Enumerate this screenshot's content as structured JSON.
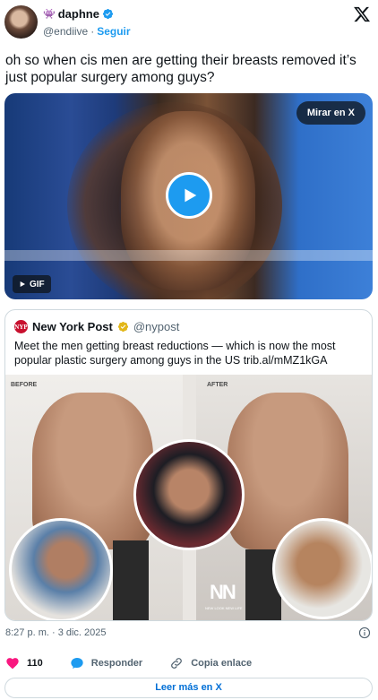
{
  "author": {
    "display_name": "daphne",
    "name_emoji": "👾",
    "handle": "@endiive",
    "separator": "·",
    "follow_label": "Seguir",
    "verified": true
  },
  "tweet": {
    "text": "oh so when cis men are getting their breasts removed it’s just popular surgery among guys?",
    "timestamp": "8:27 p. m. · 3 dic. 2025"
  },
  "media": {
    "watch_label": "Mirar en X",
    "badge": "GIF"
  },
  "quote": {
    "name": "New York Post",
    "logo_text": "NYP",
    "handle": "@nypost",
    "text": "Meet the men getting breast reductions — which is now the most popular plastic surgery among guys in the US trib.al/mMZ1kGA",
    "image": {
      "label_before": "BEFORE",
      "label_after": "AFTER",
      "mark": "NN",
      "mark_sub": "NEW LOOK NEW LIFE"
    }
  },
  "actions": {
    "likes": "110",
    "reply_label": "Responder",
    "copy_label": "Copia enlace"
  },
  "read_more": "Leer más en X",
  "colors": {
    "accent": "#1d9bf0",
    "like": "#f91880",
    "text": "#0f1419",
    "muted": "#536471",
    "link": "#006fd6"
  },
  "icons": [
    "x-logo-icon",
    "verified-badge-icon",
    "play-icon",
    "gif-play-icon",
    "gold-verified-icon",
    "info-icon",
    "heart-icon",
    "reply-icon",
    "link-icon"
  ]
}
